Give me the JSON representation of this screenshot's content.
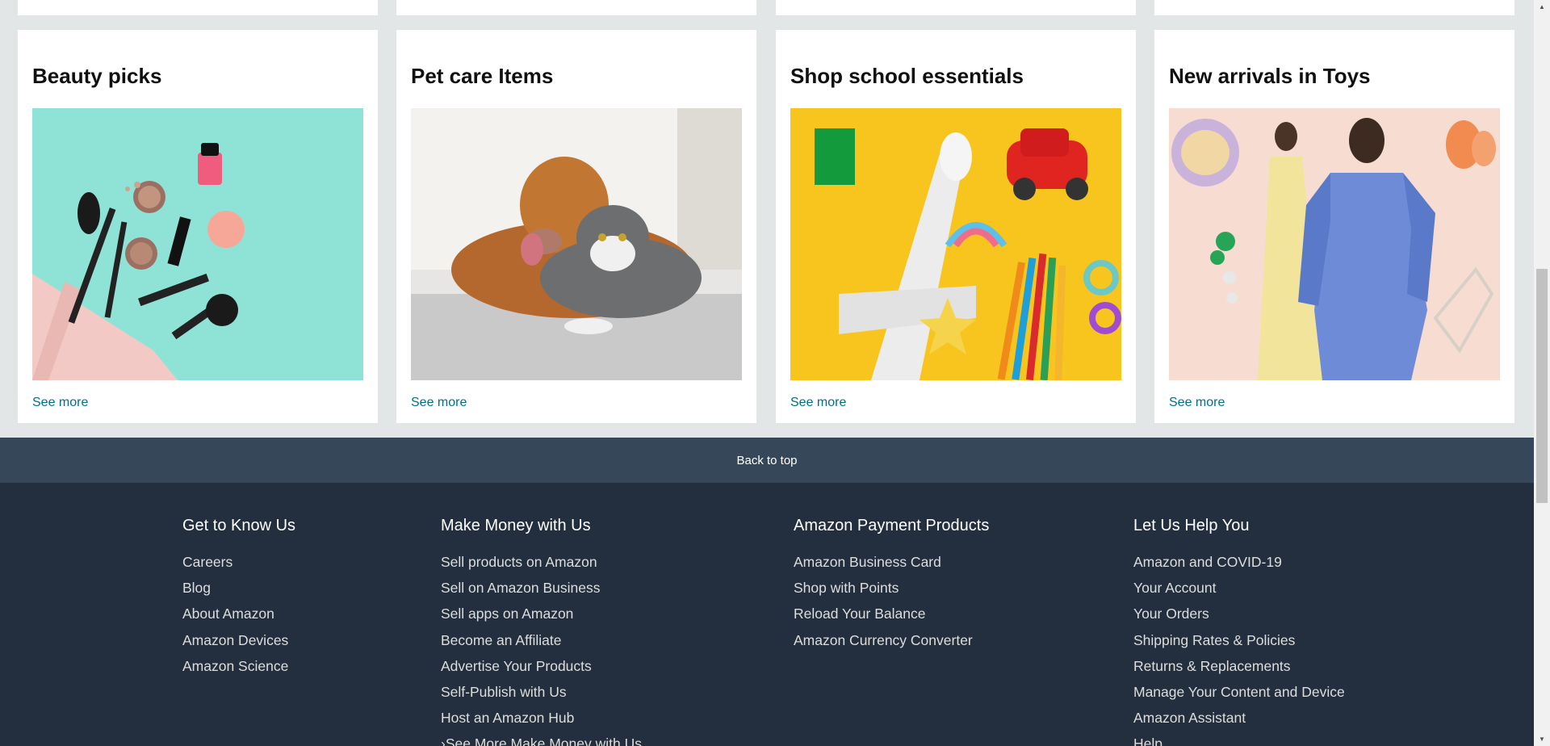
{
  "cards": [
    {
      "title": "Beauty picks",
      "link": "See more",
      "image": "beauty-products-photo"
    },
    {
      "title": "Pet care Items",
      "link": "See more",
      "image": "dog-and-cat-photo"
    },
    {
      "title": "Shop school essentials",
      "link": "See more",
      "image": "school-toys-photo"
    },
    {
      "title": "New arrivals in Toys",
      "link": "See more",
      "image": "fashion-models-photo"
    }
  ],
  "back_to_top": "Back to top",
  "footer": {
    "columns": [
      {
        "heading": "Get to Know Us",
        "items": [
          "Careers",
          "Blog",
          "About Amazon",
          "Amazon Devices",
          "Amazon Science"
        ]
      },
      {
        "heading": "Make Money with Us",
        "items": [
          "Sell products on Amazon",
          "Sell on Amazon Business",
          "Sell apps on Amazon",
          "Become an Affiliate",
          "Advertise Your Products",
          "Self-Publish with Us",
          "Host an Amazon Hub",
          "›See More Make Money with Us"
        ]
      },
      {
        "heading": "Amazon Payment Products",
        "items": [
          "Amazon Business Card",
          "Shop with Points",
          "Reload Your Balance",
          "Amazon Currency Converter"
        ]
      },
      {
        "heading": "Let Us Help You",
        "items": [
          "Amazon and COVID-19",
          "Your Account",
          "Your Orders",
          "Shipping Rates & Policies",
          "Returns & Replacements",
          "Manage Your Content and Device",
          "Amazon Assistant",
          "Help"
        ]
      }
    ]
  },
  "colors": {
    "page_bg": "#e3e6e6",
    "link": "#007185",
    "back_to_top_bg": "#37475a",
    "footer_bg": "#232f3e"
  }
}
